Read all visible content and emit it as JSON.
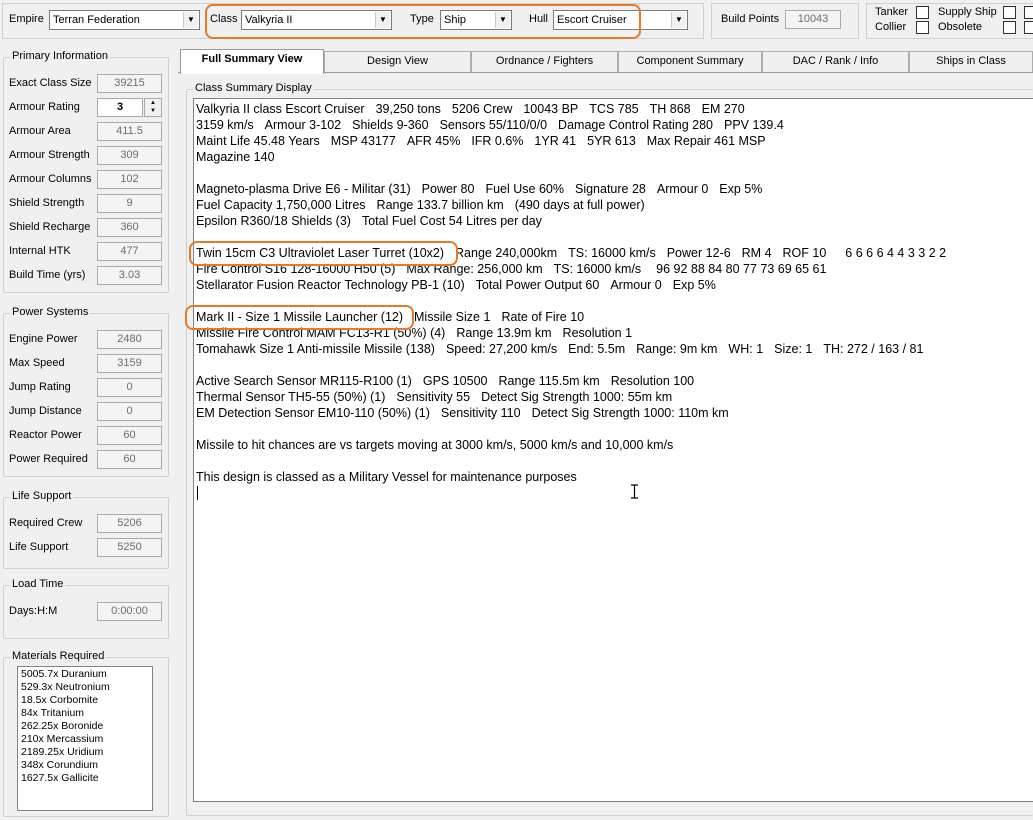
{
  "top": {
    "empire_label": "Empire",
    "empire_value": "Terran Federation",
    "class_label": "Class",
    "class_value": "Valkyria II",
    "type_label": "Type",
    "type_value": "Ship",
    "hull_label": "Hull",
    "hull_value": "Escort Cruiser",
    "bp_label": "Build Points",
    "bp_value": "10043",
    "checks": [
      "Tanker",
      "Supply Ship",
      "Collier",
      "Obsolete"
    ]
  },
  "primary": {
    "title": "Primary Information",
    "rows": [
      {
        "label": "Exact Class Size",
        "value": "39215"
      },
      {
        "label": "Armour Rating",
        "value": "3"
      },
      {
        "label": "Armour Area",
        "value": "411.5"
      },
      {
        "label": "Armour Strength",
        "value": "309"
      },
      {
        "label": "Armour Columns",
        "value": "102"
      },
      {
        "label": "Shield Strength",
        "value": "9"
      },
      {
        "label": "Shield Recharge",
        "value": "360"
      },
      {
        "label": "Internal HTK",
        "value": "477"
      },
      {
        "label": "Build Time (yrs)",
        "value": "3.03"
      }
    ]
  },
  "power": {
    "title": "Power Systems",
    "rows": [
      {
        "label": "Engine Power",
        "value": "2480"
      },
      {
        "label": "Max Speed",
        "value": "3159"
      },
      {
        "label": "Jump Rating",
        "value": "0"
      },
      {
        "label": "Jump Distance",
        "value": "0"
      },
      {
        "label": "Reactor Power",
        "value": "60"
      },
      {
        "label": "Power Required",
        "value": "60"
      }
    ]
  },
  "life": {
    "title": "Life Support",
    "rows": [
      {
        "label": "Required Crew",
        "value": "5206"
      },
      {
        "label": "Life Support",
        "value": "5250"
      }
    ]
  },
  "load": {
    "title": "Load Time",
    "label": "Days:H:M",
    "value": "0:00:00"
  },
  "materials": {
    "title": "Materials Required",
    "items": [
      "5005.7x Duranium",
      "529.3x Neutronium",
      "18.5x Corbomite",
      "84x Tritanium",
      "262.25x Boronide",
      "210x Mercassium",
      "2189.25x Uridium",
      "348x Corundium",
      "1627.5x Gallicite"
    ]
  },
  "tabs": [
    "Full Summary View",
    "Design View",
    "Ordnance / Fighters",
    "Component Summary",
    "DAC / Rank / Info",
    "Ships in Class"
  ],
  "display": {
    "title": "Class Summary Display",
    "lines": [
      [
        "Valkyria II class Escort Cruiser",
        "39,250 tons",
        "5206 Crew",
        "10043 BP",
        "TCS 785",
        "TH 868",
        "EM 270"
      ],
      [
        "3159 km/s",
        "Armour 3-102",
        "Shields 9-360",
        "Sensors 55/110/0/0",
        "Damage Control Rating 280",
        "PPV 139.4"
      ],
      [
        "Maint Life 45.48 Years",
        "MSP 43177",
        "AFR 45%",
        "IFR 0.6%",
        "1YR 41",
        "5YR 613",
        "Max Repair 461 MSP"
      ],
      [
        "Magazine 140"
      ],
      [],
      [
        "Magneto-plasma Drive E6 - Militar (31)",
        "Power 80",
        "Fuel Use 60%",
        "Signature 28",
        "Armour 0",
        "Exp 5%"
      ],
      [
        "Fuel Capacity 1,750,000 Litres",
        "Range 133.7 billion km",
        "(490 days at full power)"
      ],
      [
        "Epsilon R360/18 Shields (3)",
        "Total Fuel Cost  54 Litres per day"
      ],
      [],
      [
        "Twin 15cm C3 Ultraviolet Laser Turret (10x2)",
        "Range 240,000km",
        "TS: 16000 km/s",
        "Power 12-6",
        "RM 4",
        "ROF 10",
        "6 6 6 6 4 4 3 3 2 2"
      ],
      [
        "Fire Control S16 128-16000 H50 (5)",
        "Max Range: 256,000 km",
        "TS: 16000 km/s",
        "96 92 88 84 80 77 73 69 65 61"
      ],
      [
        "Stellarator Fusion Reactor Technology PB-1 (10)",
        "Total Power Output 60",
        "Armour 0",
        "Exp 5%"
      ],
      [],
      [
        "Mark II - Size 1 Missile Launcher (12)",
        "Missile Size 1",
        "Rate of Fire 10"
      ],
      [
        "Missile Fire Control MAM FC13-R1 (50%) (4)",
        "Range 13.9m km",
        "Resolution 1"
      ],
      [
        "Tomahawk Size 1 Anti-missile Missile (138)",
        "Speed: 27,200 km/s",
        "End: 5.5m",
        "Range: 9m km",
        "WH: 1",
        "Size: 1",
        "TH: 272 / 163 / 81"
      ],
      [],
      [
        "Active Search Sensor MR115-R100 (1)",
        "GPS 10500",
        "Range 115.5m km",
        "Resolution 100"
      ],
      [
        "Thermal Sensor TH5-55 (50%) (1)",
        "Sensitivity 55",
        "Detect Sig Strength 1000:  55m km"
      ],
      [
        "EM Detection Sensor EM10-110 (50%) (1)",
        "Sensitivity 110",
        "Detect Sig Strength 1000:  110m km"
      ],
      [],
      [
        "Missile to hit chances are vs targets moving at 3000 km/s, 5000 km/s and 10,000 km/s"
      ],
      [],
      [
        "This design is classed as a Military Vessel for maintenance purposes"
      ]
    ]
  },
  "colors": {
    "highlight": "#e8792b",
    "panel_bg": "#f0f0f0",
    "text_bg": "#ffffff"
  }
}
